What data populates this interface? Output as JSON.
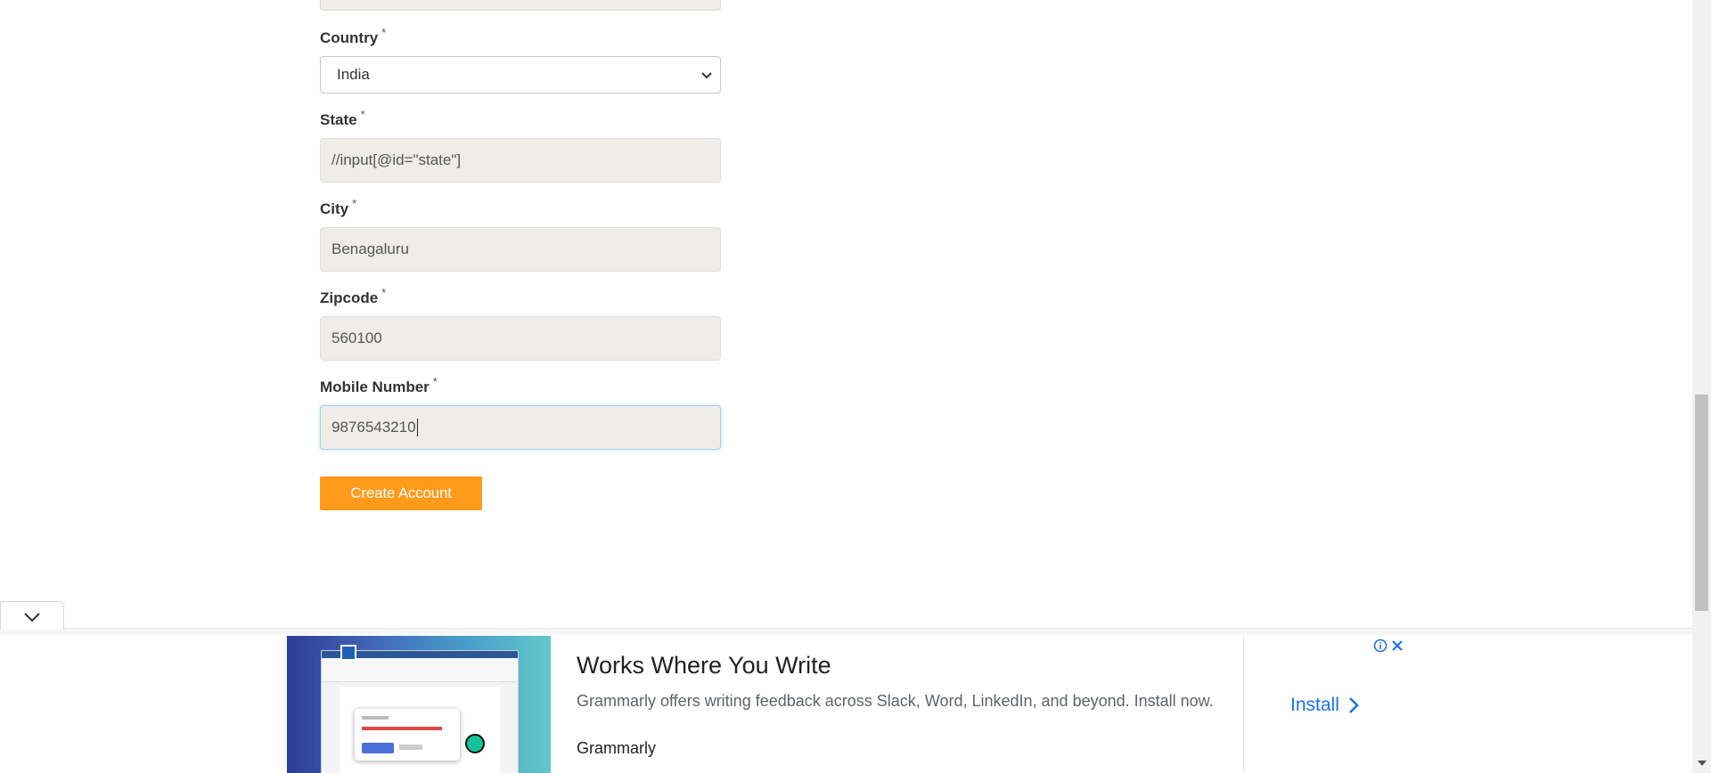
{
  "form": {
    "country": {
      "label": "Country",
      "required_mark": "*",
      "selected": "India"
    },
    "state": {
      "label": "State",
      "required_mark": "*",
      "value": "//input[@id=\"state\"]"
    },
    "city": {
      "label": "City",
      "required_mark": "*",
      "value": "Benagaluru"
    },
    "zipcode": {
      "label": "Zipcode",
      "required_mark": "*",
      "value": "560100"
    },
    "mobile": {
      "label": "Mobile Number",
      "required_mark": "*",
      "value": "9876543210"
    },
    "submit_label": "Create Account"
  },
  "ad": {
    "title": "Works Where You Write",
    "description": "Grammarly offers writing feedback across Slack, Word, LinkedIn, and beyond. Install now.",
    "brand": "Grammarly",
    "cta": "Install",
    "icons": [
      "info-icon",
      "close-icon",
      "chevron-right-icon",
      "chevron-down-icon"
    ]
  },
  "colors": {
    "button_bg": "#ff9a1a",
    "field_bg": "#eeede8",
    "link_blue": "#1a73e8"
  }
}
